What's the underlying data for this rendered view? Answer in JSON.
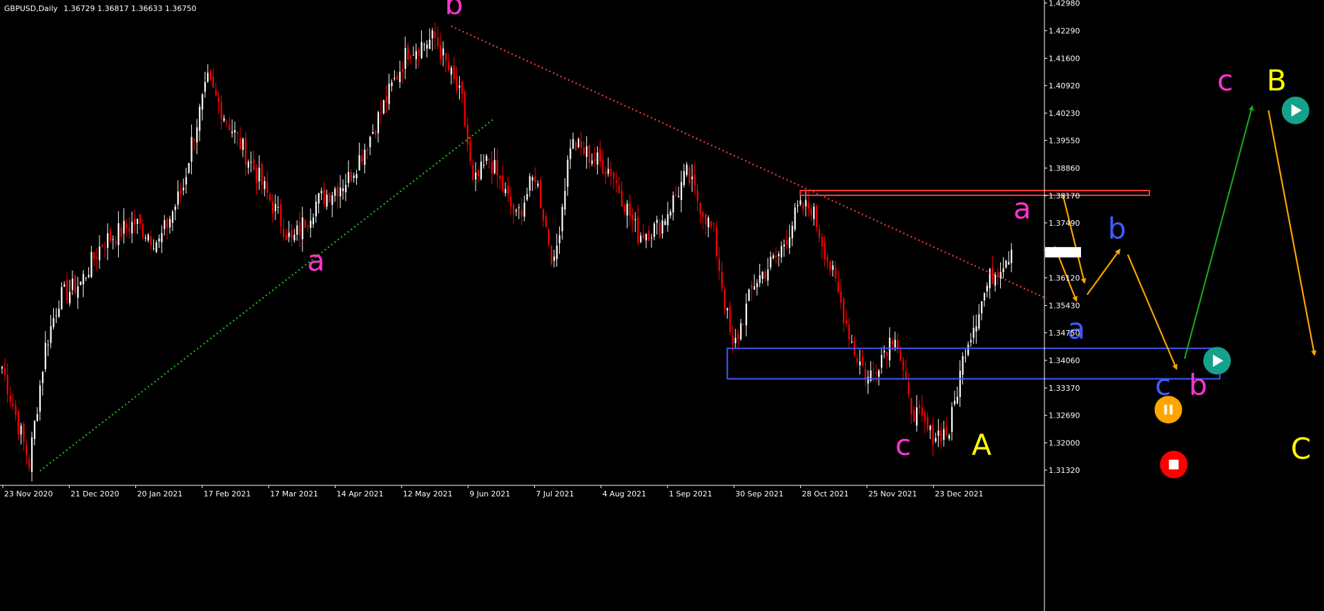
{
  "header": {
    "symbol": "GBPUSD,Daily",
    "ohlc": "1.36729 1.36817 1.36633 1.36750"
  },
  "colors": {
    "background": "#000000",
    "bull": "#ffffff",
    "bear": "#ff0000",
    "axis": "#ffffff",
    "current_price_bg": "#ffffff",
    "pink": "#ff33cc",
    "blue": "#3f5bff",
    "yellow": "#ffff00",
    "orange": "#ffa500",
    "green": "#1aa31a",
    "teal": "#15a18a",
    "red_box": "#ff3b3b"
  },
  "chart_data": {
    "type": "candlestick",
    "y_ticks": [
      "1.42980",
      "1.42290",
      "1.41600",
      "1.40920",
      "1.40230",
      "1.39550",
      "1.38860",
      "1.38170",
      "1.37490",
      "1.36810",
      "1.36120",
      "1.35430",
      "1.34750",
      "1.34060",
      "1.33370",
      "1.32690",
      "1.32000",
      "1.31320"
    ],
    "ylim": [
      1.3094,
      1.4302
    ],
    "current_price": "1.36750",
    "x_ticks": [
      "23 Nov 2020",
      "21 Dec 2020",
      "20 Jan 2021",
      "17 Feb 2021",
      "17 Mar 2021",
      "14 Apr 2021",
      "12 May 2021",
      "9 Jun 2021",
      "7 Jul 2021",
      "4 Aug 2021",
      "1 Sep 2021",
      "30 Sep 2021",
      "28 Oct 2021",
      "25 Nov 2021",
      "23 Dec 2021"
    ],
    "price_path": [
      [
        0,
        1.339
      ],
      [
        10,
        1.315
      ],
      [
        16,
        1.344
      ],
      [
        21,
        1.356
      ],
      [
        29,
        1.36
      ],
      [
        37,
        1.37
      ],
      [
        49,
        1.375
      ],
      [
        58,
        1.37
      ],
      [
        67,
        1.384
      ],
      [
        70,
        1.395
      ],
      [
        76,
        1.41
      ],
      [
        82,
        1.402
      ],
      [
        95,
        1.386
      ],
      [
        107,
        1.37
      ],
      [
        116,
        1.38
      ],
      [
        128,
        1.386
      ],
      [
        135,
        1.395
      ],
      [
        150,
        1.418
      ],
      [
        160,
        1.421
      ],
      [
        170,
        1.405
      ],
      [
        174,
        1.384
      ],
      [
        180,
        1.391
      ],
      [
        190,
        1.376
      ],
      [
        197,
        1.387
      ],
      [
        204,
        1.364
      ],
      [
        210,
        1.395
      ],
      [
        225,
        1.388
      ],
      [
        235,
        1.372
      ],
      [
        243,
        1.374
      ],
      [
        253,
        1.387
      ],
      [
        263,
        1.372
      ],
      [
        270,
        1.343
      ],
      [
        278,
        1.36
      ],
      [
        287,
        1.367
      ],
      [
        294,
        1.378
      ],
      [
        299,
        1.379
      ],
      [
        306,
        1.364
      ],
      [
        315,
        1.343
      ],
      [
        320,
        1.336
      ],
      [
        330,
        1.348
      ],
      [
        335,
        1.33
      ],
      [
        343,
        1.322
      ],
      [
        350,
        1.323
      ],
      [
        356,
        1.344
      ],
      [
        365,
        1.361
      ],
      [
        373,
        1.3682
      ]
    ],
    "trendlines": [
      {
        "name": "downtrend",
        "color": "red",
        "style": "dotted",
        "from": {
          "x": 166,
          "y": 1.424
        },
        "to": {
          "x": 386,
          "y": 1.356
        }
      },
      {
        "name": "uptrend",
        "color": "green",
        "style": "dotted",
        "from": {
          "x": 14,
          "y": 1.313
        },
        "to": {
          "x": 182,
          "y": 1.401
        }
      }
    ],
    "zones": [
      {
        "name": "resistance-zone",
        "color": "red",
        "x1": 295,
        "x2": 424,
        "y_top": 1.383,
        "y_bottom": 1.3818
      },
      {
        "name": "support-zone",
        "color": "blue",
        "x1": 268,
        "x2": 450,
        "y_top": 1.3436,
        "y_bottom": 1.336
      }
    ],
    "projection_paths": [
      {
        "color": "orange",
        "points": [
          [
            389,
            1.369
          ],
          [
            397,
            1.3555
          ]
        ]
      },
      {
        "color": "orange",
        "points": [
          [
            392,
            1.382
          ],
          [
            400,
            1.36
          ]
        ]
      },
      {
        "color": "orange",
        "points": [
          [
            401,
            1.357
          ],
          [
            413,
            1.3682
          ]
        ]
      },
      {
        "color": "orange",
        "points": [
          [
            416,
            1.367
          ],
          [
            434,
            1.3385
          ]
        ]
      },
      {
        "color": "green",
        "points": [
          [
            437,
            1.341
          ],
          [
            462,
            1.404
          ]
        ]
      },
      {
        "color": "orange",
        "points": [
          [
            468,
            1.403
          ],
          [
            485,
            1.342
          ]
        ]
      }
    ],
    "wave_labels": [
      {
        "text": "b",
        "color": "pink",
        "x": 167,
        "y": 1.427
      },
      {
        "text": "a",
        "color": "pink",
        "x": 116,
        "y": 1.363
      },
      {
        "text": "c",
        "color": "pink",
        "x": 333,
        "y": 1.317
      },
      {
        "text": "A",
        "color": "yellow",
        "x": 362,
        "y": 1.317
      },
      {
        "text": "a",
        "color": "pink",
        "x": 377,
        "y": 1.376
      },
      {
        "text": "b",
        "color": "blue",
        "x": 412,
        "y": 1.371
      },
      {
        "text": "a",
        "color": "blue",
        "x": 397,
        "y": 1.346
      },
      {
        "text": "c",
        "color": "blue",
        "x": 429,
        "y": 1.332
      },
      {
        "text": "b",
        "color": "pink",
        "x": 442,
        "y": 1.332
      },
      {
        "text": "c",
        "color": "pink",
        "x": 452,
        "y": 1.408
      },
      {
        "text": "B",
        "color": "yellow",
        "x": 471,
        "y": 1.408
      },
      {
        "text": "C",
        "color": "yellow",
        "x": 480,
        "y": 1.316
      }
    ],
    "status_markers": [
      {
        "kind": "play",
        "color": "teal",
        "x": 478,
        "y": 1.403
      },
      {
        "kind": "play",
        "color": "teal",
        "x": 449,
        "y": 1.3405
      },
      {
        "kind": "pause",
        "color": "orange",
        "x": 431,
        "y": 1.3283
      },
      {
        "kind": "stop",
        "color": "red",
        "x": 433,
        "y": 1.3146
      }
    ]
  }
}
